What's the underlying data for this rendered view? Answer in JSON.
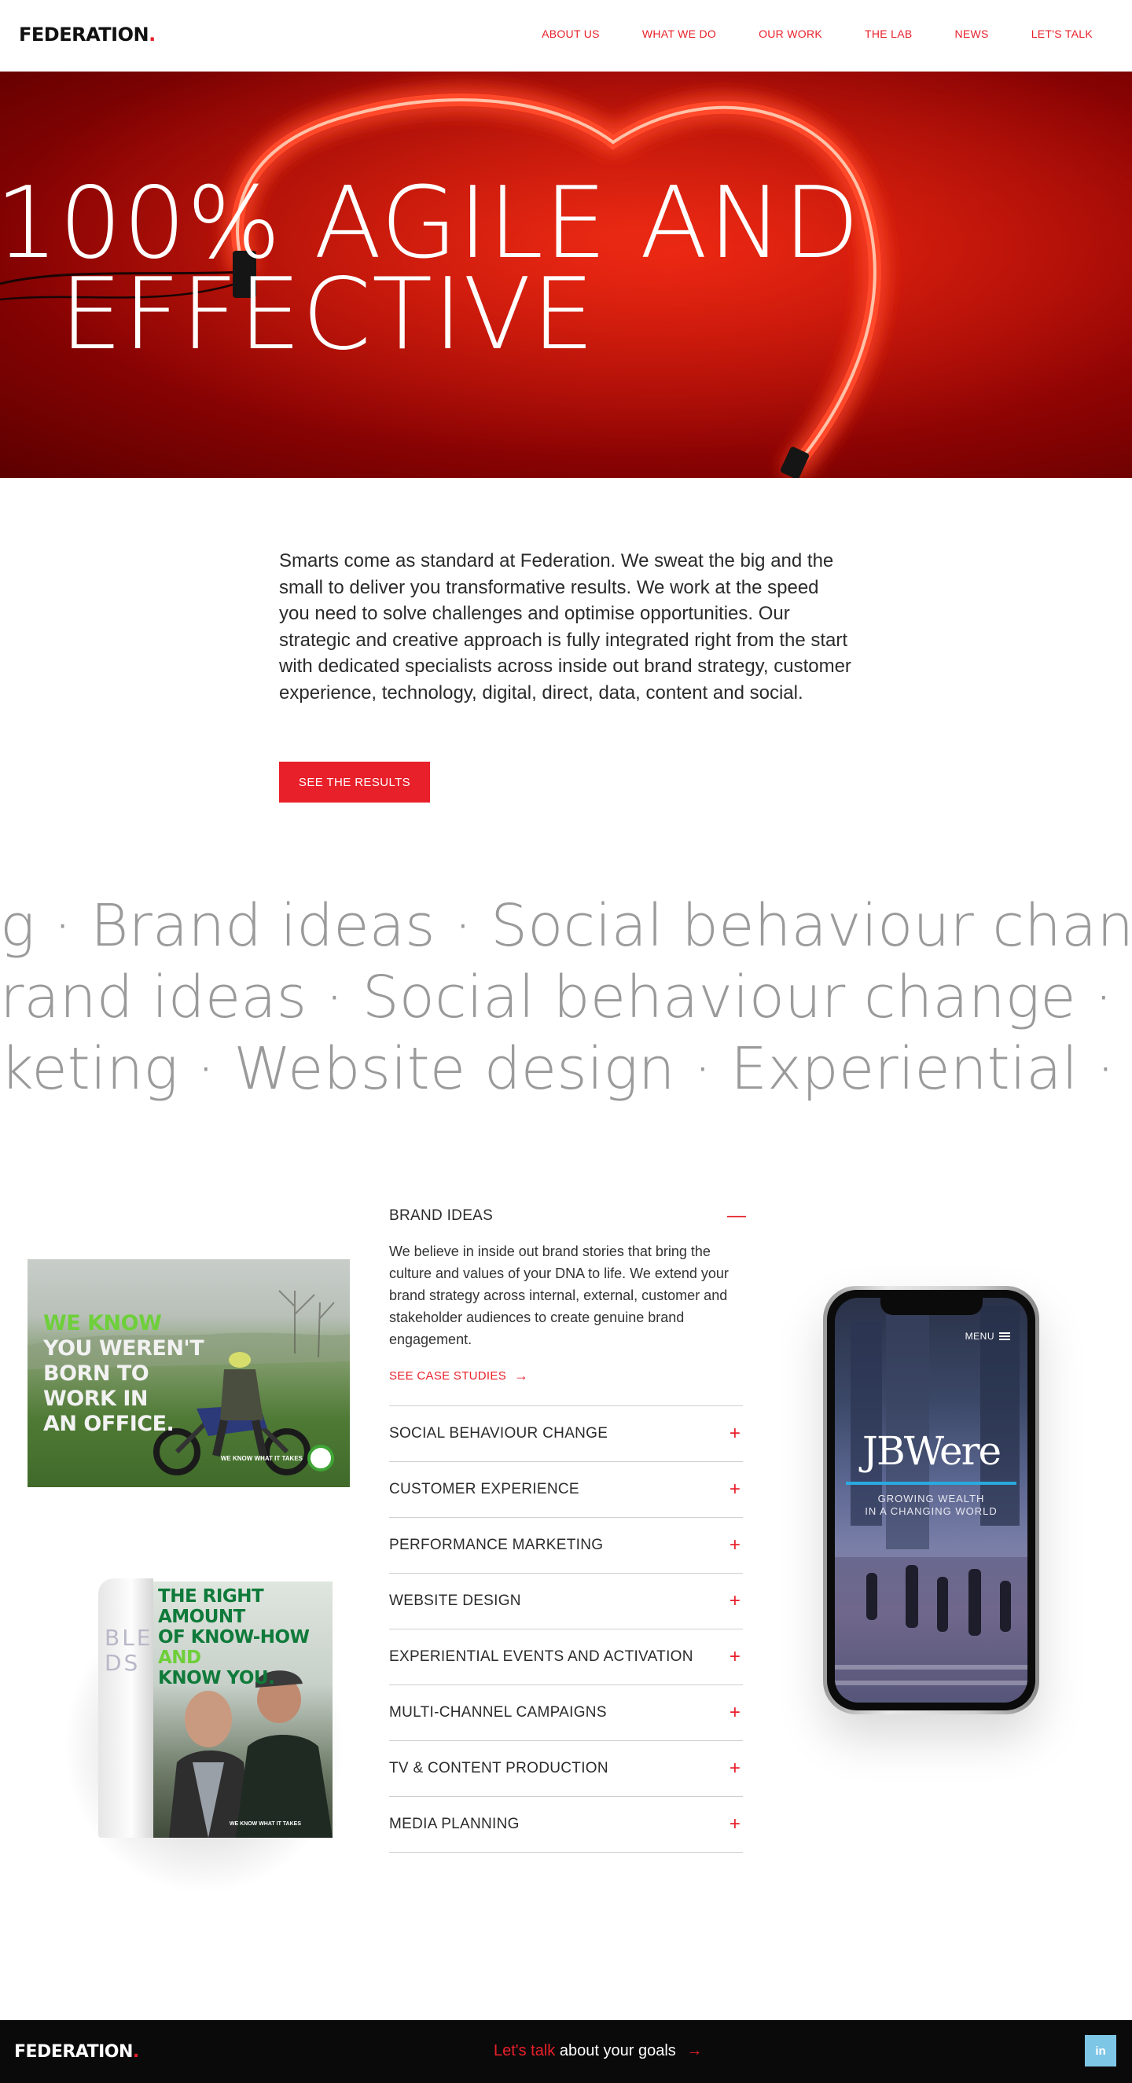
{
  "header": {
    "logo": "FEDERATION",
    "logo_dot": ".",
    "nav": [
      "ABOUT US",
      "WHAT WE DO",
      "OUR WORK",
      "THE LAB",
      "NEWS",
      "LET'S TALK"
    ]
  },
  "hero": {
    "line1": "100% AGILE AND",
    "line2": "EFFECTIVE"
  },
  "intro": {
    "text": "Smarts come as standard at Federation. We sweat the big and the small to deliver you transformative results. We work at the speed you need to solve challenges and optimise opportunities. Our strategic and creative approach is fully integrated right from the start with dedicated specialists across inside out brand strategy, customer experience, technology, digital, direct, data, content and social.",
    "cta": "SEE THE RESULTS"
  },
  "marquee": {
    "row1": "g · Brand ideas · Social behaviour change",
    "row2": "rand ideas · Social behaviour change · Cus",
    "row3": "keting · Website design · Experiential · Mu"
  },
  "ads": {
    "ad1_line1": "WE KNOW",
    "ad1_line2": "YOU WEREN'T",
    "ad1_line3": "BORN TO",
    "ad1_line4": "WORK IN",
    "ad1_line5": "AN OFFICE.",
    "ad1_tag": "WE KNOW WHAT IT TAKES",
    "mag_left": "BLE\nDS",
    "mag_head1": "THE RIGHT AMOUNT",
    "mag_head2": "OF KNOW-HOW",
    "mag_head2b": "AND",
    "mag_head3": "KNOW YOU.",
    "mag_tag": "WE KNOW WHAT IT TAKES"
  },
  "accordion": {
    "open_title": "BRAND IDEAS",
    "open_body": "We believe in inside out brand stories that bring the culture and values of your DNA to life. We extend your brand strategy across internal, external, customer and stakeholder audiences to create genuine brand engagement.",
    "open_link": "SEE CASE STUDIES",
    "collapse_sign": "—",
    "expand_sign": "+",
    "items": [
      "SOCIAL BEHAVIOUR CHANGE",
      "CUSTOMER EXPERIENCE",
      "PERFORMANCE MARKETING",
      "WEBSITE DESIGN",
      "EXPERIENTIAL EVENTS AND ACTIVATION",
      "MULTI-CHANNEL CAMPAIGNS",
      "TV & CONTENT PRODUCTION",
      "MEDIA PLANNING"
    ]
  },
  "phone": {
    "menu": "MENU",
    "brand": "JBWere",
    "tagline1": "GROWING WEALTH",
    "tagline2": "IN A CHANGING WORLD"
  },
  "footer": {
    "logo": "FEDERATION",
    "logo_dot": ".",
    "talk_red": "Let's talk",
    "talk_rest": "about your goals",
    "social": "in"
  },
  "colors": {
    "accent": "#e8202a",
    "hero_bg": "#8a0303",
    "marquee_text": "#9a9a9a",
    "linkedin": "#7ec6e6",
    "footer_bg": "#0a0a0a"
  }
}
